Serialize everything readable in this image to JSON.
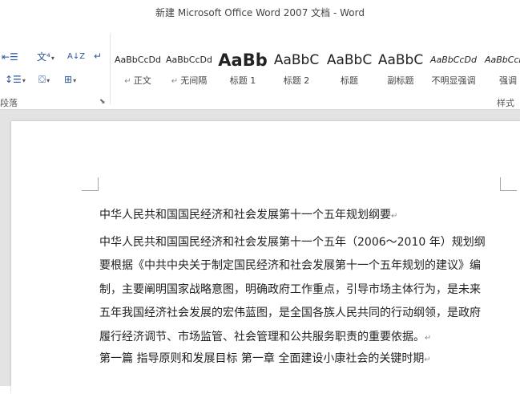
{
  "window": {
    "title": "新建 Microsoft Office Word 2007 文档 - Word"
  },
  "ribbon": {
    "paragraph_group": {
      "label": "段落",
      "launcher_glyph": "⬊",
      "tools": [
        {
          "name": "indent-button",
          "glyph": "⇤☰",
          "caret": ""
        },
        {
          "name": "chinese-layout-button",
          "glyph": "文⁴",
          "caret": "▾"
        },
        {
          "name": "sort-button",
          "glyph": "A↓Z",
          "caret": ""
        },
        {
          "name": "show-hide-marks-button",
          "glyph": "↵",
          "caret": ""
        },
        {
          "name": "line-spacing-button",
          "glyph": "↕☰",
          "caret": "▾"
        },
        {
          "name": "shading-button",
          "glyph": "⛋",
          "caret": "▾"
        },
        {
          "name": "borders-button",
          "glyph": "⊞",
          "caret": "▾"
        }
      ]
    },
    "styles_group": {
      "label": "样式",
      "items": [
        {
          "preview": "AaBbCcDd",
          "label": "正文",
          "mark": "↵ ",
          "size": "11px",
          "weight": "normal",
          "style": "normal"
        },
        {
          "preview": "AaBbCcDd",
          "label": "无间隔",
          "mark": "↵ ",
          "size": "11px",
          "weight": "normal",
          "style": "normal"
        },
        {
          "preview": "AaBb",
          "label": "标题 1",
          "mark": "",
          "size": "21px",
          "weight": "bold",
          "style": "normal"
        },
        {
          "preview": "AaBbC",
          "label": "标题 2",
          "mark": "",
          "size": "17px",
          "weight": "normal",
          "style": "normal"
        },
        {
          "preview": "AaBbC",
          "label": "标题",
          "mark": "",
          "size": "17px",
          "weight": "normal",
          "style": "normal"
        },
        {
          "preview": "AaBbC",
          "label": "副标题",
          "mark": "",
          "size": "17px",
          "weight": "normal",
          "style": "normal"
        },
        {
          "preview": "AaBbCcDd",
          "label": "不明显强调",
          "mark": "",
          "size": "11px",
          "weight": "normal",
          "style": "italic"
        },
        {
          "preview": "AaBbCcDd",
          "label": "强调",
          "mark": "",
          "size": "11px",
          "weight": "normal",
          "style": "italic"
        }
      ]
    }
  },
  "document": {
    "paragraph_mark": "↵",
    "heading": "中华人民共和国国民经济和社会发展第十一个五年规划纲要",
    "body_lines": [
      "中华人民共和国国民经济和社会发展第十一个五年（2006～2010 年）规划纲",
      "要根据《中共中央关于制定国民经济和社会发展第十一个五年规划的建议》编",
      "制，主要阐明国家战略意图，明确政府工作重点，引导市场主体行为，是未来",
      "五年我国经济社会发展的宏伟蓝图，是全国各族人民共同的行动纲领，是政府",
      "履行经济调节、市场监管、社会管理和公共服务职责的重要依据。"
    ],
    "section": "第一篇  指导原则和发展目标  第一章  全面建设小康社会的关键时期"
  }
}
